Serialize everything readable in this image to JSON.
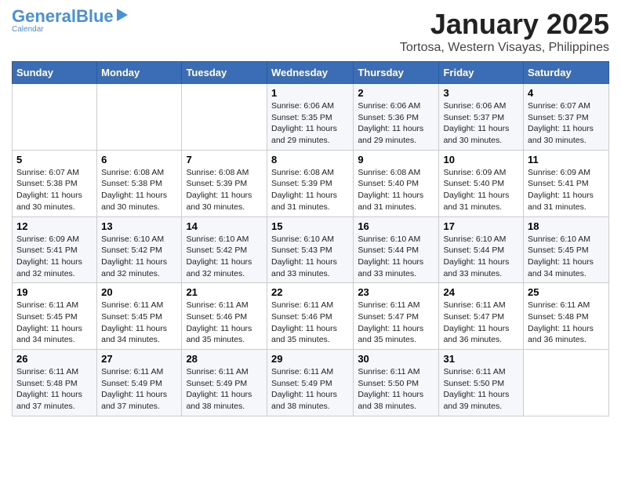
{
  "logo": {
    "part1": "General",
    "part2": "Blue",
    "tagline": "Calendar"
  },
  "title": "January 2025",
  "subtitle": "Tortosa, Western Visayas, Philippines",
  "headers": [
    "Sunday",
    "Monday",
    "Tuesday",
    "Wednesday",
    "Thursday",
    "Friday",
    "Saturday"
  ],
  "weeks": [
    [
      {
        "day": "",
        "sunrise": "",
        "sunset": "",
        "daylight": ""
      },
      {
        "day": "",
        "sunrise": "",
        "sunset": "",
        "daylight": ""
      },
      {
        "day": "",
        "sunrise": "",
        "sunset": "",
        "daylight": ""
      },
      {
        "day": "1",
        "sunrise": "Sunrise: 6:06 AM",
        "sunset": "Sunset: 5:35 PM",
        "daylight": "Daylight: 11 hours and 29 minutes."
      },
      {
        "day": "2",
        "sunrise": "Sunrise: 6:06 AM",
        "sunset": "Sunset: 5:36 PM",
        "daylight": "Daylight: 11 hours and 29 minutes."
      },
      {
        "day": "3",
        "sunrise": "Sunrise: 6:06 AM",
        "sunset": "Sunset: 5:37 PM",
        "daylight": "Daylight: 11 hours and 30 minutes."
      },
      {
        "day": "4",
        "sunrise": "Sunrise: 6:07 AM",
        "sunset": "Sunset: 5:37 PM",
        "daylight": "Daylight: 11 hours and 30 minutes."
      }
    ],
    [
      {
        "day": "5",
        "sunrise": "Sunrise: 6:07 AM",
        "sunset": "Sunset: 5:38 PM",
        "daylight": "Daylight: 11 hours and 30 minutes."
      },
      {
        "day": "6",
        "sunrise": "Sunrise: 6:08 AM",
        "sunset": "Sunset: 5:38 PM",
        "daylight": "Daylight: 11 hours and 30 minutes."
      },
      {
        "day": "7",
        "sunrise": "Sunrise: 6:08 AM",
        "sunset": "Sunset: 5:39 PM",
        "daylight": "Daylight: 11 hours and 30 minutes."
      },
      {
        "day": "8",
        "sunrise": "Sunrise: 6:08 AM",
        "sunset": "Sunset: 5:39 PM",
        "daylight": "Daylight: 11 hours and 31 minutes."
      },
      {
        "day": "9",
        "sunrise": "Sunrise: 6:08 AM",
        "sunset": "Sunset: 5:40 PM",
        "daylight": "Daylight: 11 hours and 31 minutes."
      },
      {
        "day": "10",
        "sunrise": "Sunrise: 6:09 AM",
        "sunset": "Sunset: 5:40 PM",
        "daylight": "Daylight: 11 hours and 31 minutes."
      },
      {
        "day": "11",
        "sunrise": "Sunrise: 6:09 AM",
        "sunset": "Sunset: 5:41 PM",
        "daylight": "Daylight: 11 hours and 31 minutes."
      }
    ],
    [
      {
        "day": "12",
        "sunrise": "Sunrise: 6:09 AM",
        "sunset": "Sunset: 5:41 PM",
        "daylight": "Daylight: 11 hours and 32 minutes."
      },
      {
        "day": "13",
        "sunrise": "Sunrise: 6:10 AM",
        "sunset": "Sunset: 5:42 PM",
        "daylight": "Daylight: 11 hours and 32 minutes."
      },
      {
        "day": "14",
        "sunrise": "Sunrise: 6:10 AM",
        "sunset": "Sunset: 5:42 PM",
        "daylight": "Daylight: 11 hours and 32 minutes."
      },
      {
        "day": "15",
        "sunrise": "Sunrise: 6:10 AM",
        "sunset": "Sunset: 5:43 PM",
        "daylight": "Daylight: 11 hours and 33 minutes."
      },
      {
        "day": "16",
        "sunrise": "Sunrise: 6:10 AM",
        "sunset": "Sunset: 5:44 PM",
        "daylight": "Daylight: 11 hours and 33 minutes."
      },
      {
        "day": "17",
        "sunrise": "Sunrise: 6:10 AM",
        "sunset": "Sunset: 5:44 PM",
        "daylight": "Daylight: 11 hours and 33 minutes."
      },
      {
        "day": "18",
        "sunrise": "Sunrise: 6:10 AM",
        "sunset": "Sunset: 5:45 PM",
        "daylight": "Daylight: 11 hours and 34 minutes."
      }
    ],
    [
      {
        "day": "19",
        "sunrise": "Sunrise: 6:11 AM",
        "sunset": "Sunset: 5:45 PM",
        "daylight": "Daylight: 11 hours and 34 minutes."
      },
      {
        "day": "20",
        "sunrise": "Sunrise: 6:11 AM",
        "sunset": "Sunset: 5:45 PM",
        "daylight": "Daylight: 11 hours and 34 minutes."
      },
      {
        "day": "21",
        "sunrise": "Sunrise: 6:11 AM",
        "sunset": "Sunset: 5:46 PM",
        "daylight": "Daylight: 11 hours and 35 minutes."
      },
      {
        "day": "22",
        "sunrise": "Sunrise: 6:11 AM",
        "sunset": "Sunset: 5:46 PM",
        "daylight": "Daylight: 11 hours and 35 minutes."
      },
      {
        "day": "23",
        "sunrise": "Sunrise: 6:11 AM",
        "sunset": "Sunset: 5:47 PM",
        "daylight": "Daylight: 11 hours and 35 minutes."
      },
      {
        "day": "24",
        "sunrise": "Sunrise: 6:11 AM",
        "sunset": "Sunset: 5:47 PM",
        "daylight": "Daylight: 11 hours and 36 minutes."
      },
      {
        "day": "25",
        "sunrise": "Sunrise: 6:11 AM",
        "sunset": "Sunset: 5:48 PM",
        "daylight": "Daylight: 11 hours and 36 minutes."
      }
    ],
    [
      {
        "day": "26",
        "sunrise": "Sunrise: 6:11 AM",
        "sunset": "Sunset: 5:48 PM",
        "daylight": "Daylight: 11 hours and 37 minutes."
      },
      {
        "day": "27",
        "sunrise": "Sunrise: 6:11 AM",
        "sunset": "Sunset: 5:49 PM",
        "daylight": "Daylight: 11 hours and 37 minutes."
      },
      {
        "day": "28",
        "sunrise": "Sunrise: 6:11 AM",
        "sunset": "Sunset: 5:49 PM",
        "daylight": "Daylight: 11 hours and 38 minutes."
      },
      {
        "day": "29",
        "sunrise": "Sunrise: 6:11 AM",
        "sunset": "Sunset: 5:49 PM",
        "daylight": "Daylight: 11 hours and 38 minutes."
      },
      {
        "day": "30",
        "sunrise": "Sunrise: 6:11 AM",
        "sunset": "Sunset: 5:50 PM",
        "daylight": "Daylight: 11 hours and 38 minutes."
      },
      {
        "day": "31",
        "sunrise": "Sunrise: 6:11 AM",
        "sunset": "Sunset: 5:50 PM",
        "daylight": "Daylight: 11 hours and 39 minutes."
      },
      {
        "day": "",
        "sunrise": "",
        "sunset": "",
        "daylight": ""
      }
    ]
  ]
}
